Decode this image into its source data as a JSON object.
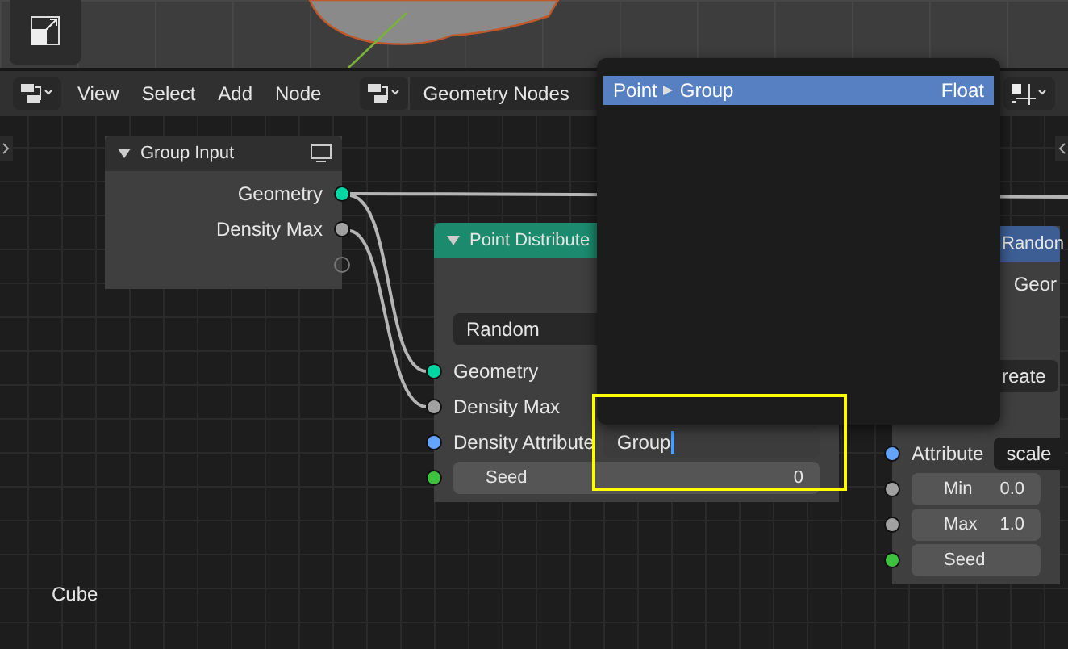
{
  "header": {
    "menus": [
      "View",
      "Select",
      "Add",
      "Node"
    ],
    "tree_name": "Geometry Nodes"
  },
  "nodes": [
    {
      "title": "Group Input",
      "color": "#2f2f2f",
      "rows": [
        {
          "kind": "output",
          "label": "Geometry",
          "color": "#00d6a3"
        },
        {
          "kind": "output",
          "label": "Density Max",
          "color": "#a1a1a1"
        },
        {
          "kind": "virtual"
        }
      ]
    },
    {
      "title": "Point Distribute",
      "color": "#1b8a6d",
      "rows": [
        {
          "kind": "dropdown",
          "value": "Random"
        },
        {
          "kind": "input",
          "label": "Geometry",
          "color": "#00d6a3"
        },
        {
          "kind": "input",
          "label": "Density Max",
          "color": "#a1a1a1"
        },
        {
          "kind": "field",
          "label": "Density Attribute",
          "value": "Group",
          "editing": true,
          "color": "#63a4ff"
        },
        {
          "kind": "number",
          "label": "Seed",
          "value": "0",
          "color": "#3ec23e"
        }
      ]
    },
    {
      "title": "Randon",
      "color": "#3d5e94",
      "rows": [
        {
          "kind": "output",
          "label": "Geor"
        },
        {
          "kind": "dropdown",
          "value": "reate"
        },
        {
          "kind": "field",
          "label": "Attribute",
          "value": "scale",
          "editing": false,
          "color": "#63a4ff"
        },
        {
          "kind": "number",
          "label": "Min",
          "value": "0.0",
          "color": "#a1a1a1"
        },
        {
          "kind": "number",
          "label": "Max",
          "value": "1.0",
          "color": "#a1a1a1"
        },
        {
          "kind": "number",
          "label": "Seed",
          "color": "#3ec23e"
        }
      ]
    }
  ],
  "popup": {
    "items": [
      {
        "path": "Point",
        "name": "Group",
        "type": "Float",
        "selected": true
      }
    ]
  },
  "object_name": "Cube"
}
